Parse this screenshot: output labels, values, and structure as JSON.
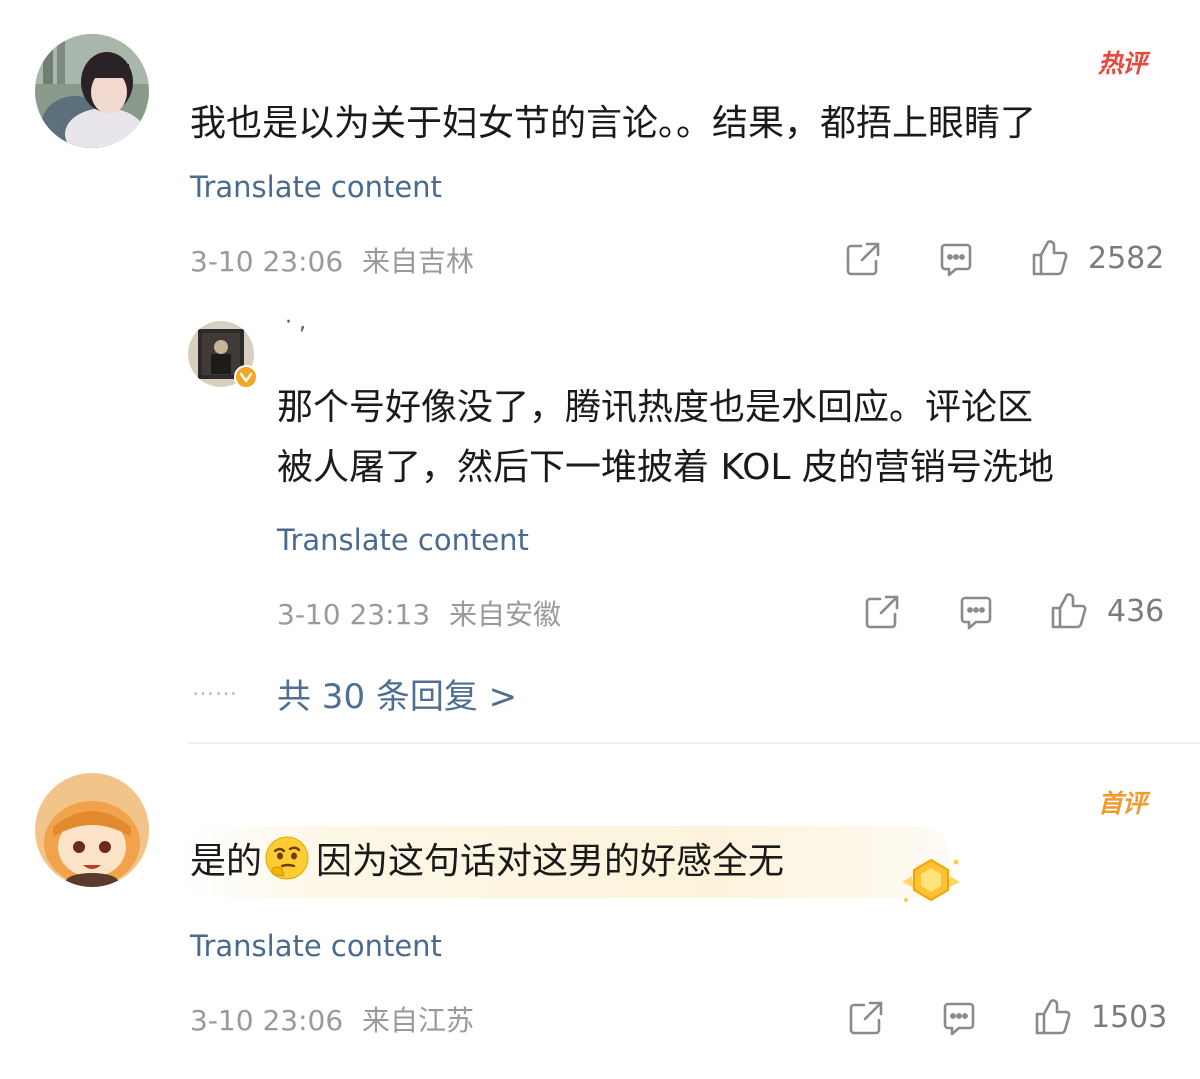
{
  "comments": [
    {
      "badge": "热评",
      "text": "我也是以为关于妇女节的言论。。结果，都捂上眼睛了",
      "translate": "Translate content",
      "time": "3-10 23:06",
      "location": "来自吉林",
      "likes": "2582",
      "reply": {
        "username": "· ,",
        "text_line1": "那个号好像没了，腾讯热度也是水回应。评论区",
        "text_line2": "被人屠了，然后下一堆披着 KOL 皮的营销号洗地",
        "translate": "Translate content",
        "time": "3-10 23:13",
        "location": "来自安徽",
        "likes": "436"
      },
      "replies_dots": "……",
      "replies_link": "共 30 条回复 >"
    },
    {
      "badge": "首评",
      "text_before": "是的",
      "text_after": "因为这句话对这男的好感全无",
      "translate": "Translate content",
      "time": "3-10 23:06",
      "location": "来自江苏",
      "likes": "1503"
    }
  ],
  "icons": {
    "share": "share-icon",
    "comment": "comment-icon",
    "like": "thumbs-up-icon",
    "emoji": "thinking-emoji-icon",
    "verified": "verified-badge-icon",
    "highlight": "highlight-medal-icon"
  },
  "colors": {
    "hot_badge": "#e8473c",
    "first_badge": "#f29a2e",
    "link": "#4a6b8f",
    "meta": "#9a9a9a"
  }
}
